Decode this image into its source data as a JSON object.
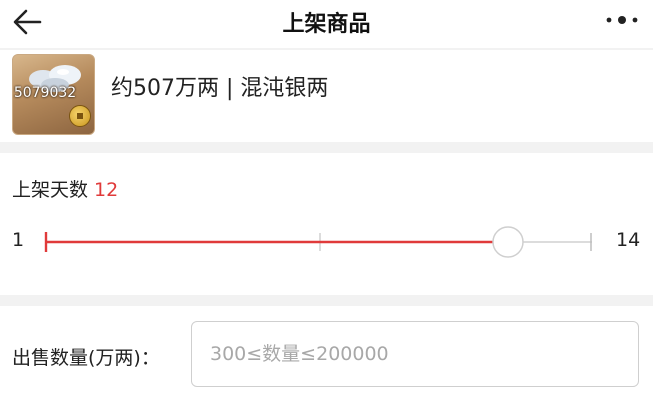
{
  "header": {
    "title": "上架商品",
    "back_icon": "arrow-left-icon",
    "more_icon": "more-dots-icon"
  },
  "item": {
    "amount_badge": "5079032",
    "description": "约507万两 | 混沌银两",
    "icon": "silver-coin-icon"
  },
  "listing_days": {
    "label": "上架天数",
    "value": "12",
    "min": "1",
    "max": "14",
    "accent_color": "#e03a3a"
  },
  "quantity": {
    "label": "出售数量(万两)：",
    "value": "",
    "placeholder": "300≤数量≤200000"
  }
}
